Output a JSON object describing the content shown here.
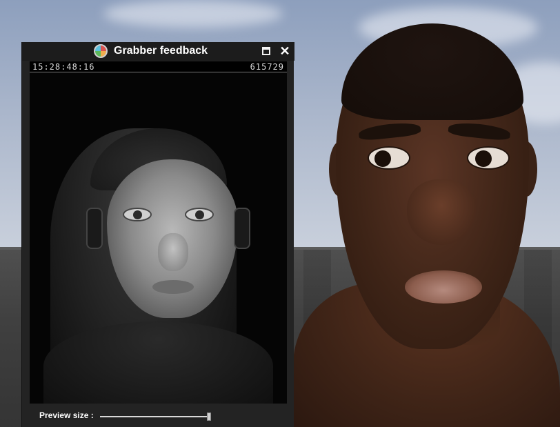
{
  "window": {
    "title": "Grabber feedback",
    "app_icon": "grabber-app-icon",
    "restore_icon": "restore-icon",
    "close_icon": "close-icon",
    "close_glyph": "✕"
  },
  "video": {
    "timecode": "15:28:48:16",
    "frame_count": "615729"
  },
  "preview": {
    "label": "Preview size :",
    "slider_value": 1.0
  },
  "colors": {
    "panel_bg": "#232323",
    "titlebar_bg": "#1c1c1c",
    "text": "#ffffff"
  }
}
